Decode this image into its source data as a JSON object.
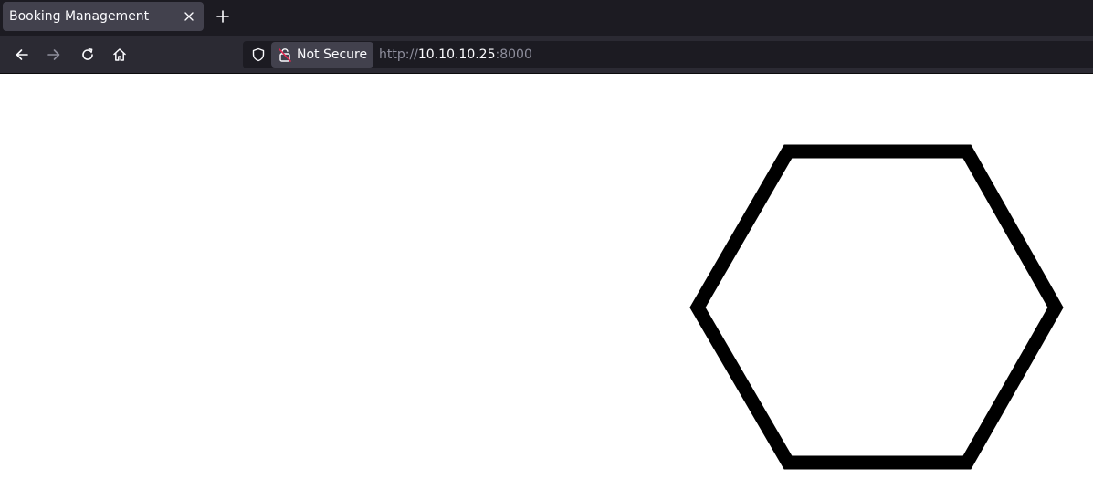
{
  "tab": {
    "title": "Booking Management",
    "close_icon": "close-icon",
    "new_tab_icon": "plus-icon"
  },
  "navbar": {
    "back_icon": "arrow-left-icon",
    "forward_icon": "arrow-right-icon",
    "reload_icon": "reload-icon",
    "home_icon": "home-icon"
  },
  "urlbar": {
    "security_label": "Not Secure",
    "scheme": "http://",
    "host": "10.10.10.25",
    "port": ":8000",
    "shield_icon": "shield-icon",
    "lock_icon": "insecure-lock-icon"
  },
  "page": {
    "graphic": "hexagon-outline",
    "graphic_color": "#000000"
  },
  "colors": {
    "tabbar_bg": "#1c1b22",
    "active_tab_bg": "#42414d",
    "navbar_bg": "#2b2a33",
    "insecure_lock": "#e22850"
  }
}
